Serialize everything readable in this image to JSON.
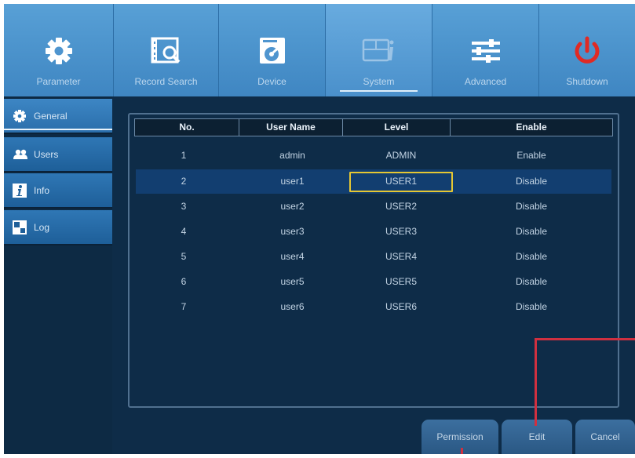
{
  "toolbar": {
    "items": [
      {
        "label": "Parameter",
        "icon": "gear-icon"
      },
      {
        "label": "Record Search",
        "icon": "film-search-icon"
      },
      {
        "label": "Device",
        "icon": "disk-device-icon"
      },
      {
        "label": "System",
        "icon": "system-info-icon"
      },
      {
        "label": "Advanced",
        "icon": "sliders-icon"
      },
      {
        "label": "Shutdown",
        "icon": "power-icon"
      }
    ],
    "active": "System"
  },
  "sidebar": {
    "items": [
      {
        "label": "General",
        "icon": "gear-icon"
      },
      {
        "label": "Users",
        "icon": "users-icon"
      },
      {
        "label": "Info",
        "icon": "info-icon"
      },
      {
        "label": "Log",
        "icon": "log-icon"
      }
    ]
  },
  "table": {
    "columns": [
      "No.",
      "User Name",
      "Level",
      "Enable"
    ],
    "rows": [
      {
        "no": "1",
        "name": "admin",
        "level": "ADMIN",
        "enable": "Enable"
      },
      {
        "no": "2",
        "name": "user1",
        "level": "USER1",
        "enable": "Disable"
      },
      {
        "no": "3",
        "name": "user2",
        "level": "USER2",
        "enable": "Disable"
      },
      {
        "no": "4",
        "name": "user3",
        "level": "USER3",
        "enable": "Disable"
      },
      {
        "no": "5",
        "name": "user4",
        "level": "USER4",
        "enable": "Disable"
      },
      {
        "no": "6",
        "name": "user5",
        "level": "USER5",
        "enable": "Disable"
      },
      {
        "no": "7",
        "name": "user6",
        "level": "USER6",
        "enable": "Disable"
      }
    ],
    "selected_row": "2"
  },
  "buttons": {
    "permission": "Permission",
    "edit": "Edit",
    "cancel": "Cancel"
  },
  "colors": {
    "toolbar": "#4a90cb",
    "background": "#0e2c48",
    "selected_row": "#123e70",
    "focus": "#e5c733",
    "callout": "#d03040",
    "shutdown": "#e02a24"
  }
}
